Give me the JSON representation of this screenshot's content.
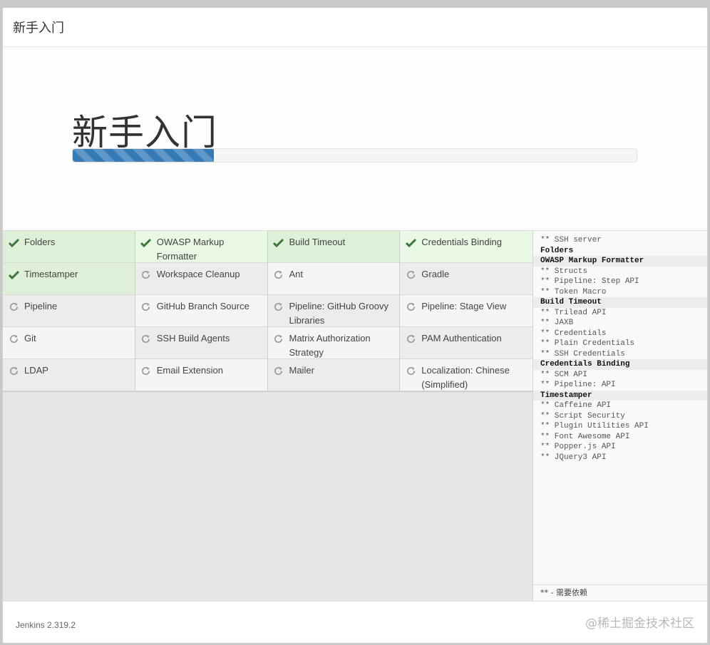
{
  "dialog": {
    "header_title": "新手入门",
    "hero_title": "新手入门",
    "progress_percent": 25
  },
  "plugins": [
    {
      "name": "Folders",
      "status": "done"
    },
    {
      "name": "OWASP Markup Formatter",
      "status": "done"
    },
    {
      "name": "Build Timeout",
      "status": "done"
    },
    {
      "name": "Credentials Binding",
      "status": "done"
    },
    {
      "name": "Timestamper",
      "status": "done"
    },
    {
      "name": "Workspace Cleanup",
      "status": "pending"
    },
    {
      "name": "Ant",
      "status": "pending"
    },
    {
      "name": "Gradle",
      "status": "pending"
    },
    {
      "name": "Pipeline",
      "status": "pending"
    },
    {
      "name": "GitHub Branch Source",
      "status": "pending"
    },
    {
      "name": "Pipeline: GitHub Groovy Libraries",
      "status": "pending"
    },
    {
      "name": "Pipeline: Stage View",
      "status": "pending"
    },
    {
      "name": "Git",
      "status": "pending"
    },
    {
      "name": "SSH Build Agents",
      "status": "pending"
    },
    {
      "name": "Matrix Authorization Strategy",
      "status": "pending"
    },
    {
      "name": "PAM Authentication",
      "status": "pending"
    },
    {
      "name": "LDAP",
      "status": "pending"
    },
    {
      "name": "Email Extension",
      "status": "pending"
    },
    {
      "name": "Mailer",
      "status": "pending"
    },
    {
      "name": "Localization: Chinese (Simplified)",
      "status": "pending"
    }
  ],
  "log": {
    "lines": [
      {
        "text": "** SSH server",
        "head": false
      },
      {
        "text": "Folders",
        "head": true
      },
      {
        "text": "OWASP Markup Formatter",
        "head": true
      },
      {
        "text": "** Structs",
        "head": false
      },
      {
        "text": "** Pipeline: Step API",
        "head": false
      },
      {
        "text": "** Token Macro",
        "head": false
      },
      {
        "text": "Build Timeout",
        "head": true
      },
      {
        "text": "** Trilead API",
        "head": false
      },
      {
        "text": "** JAXB",
        "head": false
      },
      {
        "text": "** Credentials",
        "head": false
      },
      {
        "text": "** Plain Credentials",
        "head": false
      },
      {
        "text": "** SSH Credentials",
        "head": false
      },
      {
        "text": "Credentials Binding",
        "head": true
      },
      {
        "text": "** SCM API",
        "head": false
      },
      {
        "text": "** Pipeline: API",
        "head": false
      },
      {
        "text": "Timestamper",
        "head": true
      },
      {
        "text": "** Caffeine API",
        "head": false
      },
      {
        "text": "** Script Security",
        "head": false
      },
      {
        "text": "** Plugin Utilities API",
        "head": false
      },
      {
        "text": "** Font Awesome API",
        "head": false
      },
      {
        "text": "** Popper.js API",
        "head": false
      },
      {
        "text": "** JQuery3 API",
        "head": false
      }
    ],
    "footer": "** - 需要依赖"
  },
  "footer": {
    "version": "Jenkins 2.319.2",
    "watermark": "@稀土掘金技术社区"
  },
  "colors": {
    "accent": "#337ab7",
    "success_icon": "#3c763d",
    "pending_icon": "#9a9a9a"
  },
  "icons": {
    "done": "check-icon",
    "pending": "refresh-icon"
  }
}
